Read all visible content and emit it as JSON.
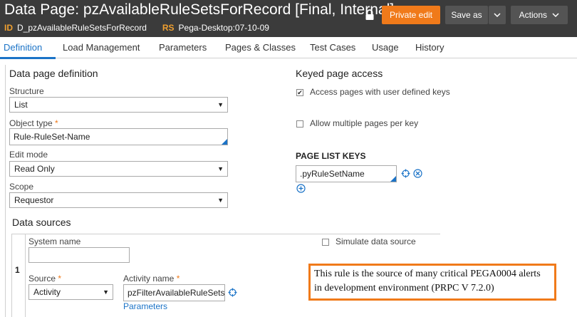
{
  "header": {
    "title": "Data Page: pzAvailableRuleSetsForRecord [Final, Internal]",
    "id_tag": "ID",
    "id_value": "D_pzAvailableRuleSetsForRecord",
    "rs_tag": "RS",
    "rs_value": "Pega-Desktop:07-10-09",
    "private_edit": "Private edit",
    "save_as": "Save as",
    "actions": "Actions"
  },
  "tabs": [
    "Definition",
    "Load Management",
    "Parameters",
    "Pages & Classes",
    "Test Cases",
    "Usage",
    "History"
  ],
  "definition": {
    "heading": "Data page definition",
    "structure_label": "Structure",
    "structure_value": "List",
    "object_type_label": "Object type",
    "object_type_value": "Rule-RuleSet-Name",
    "edit_mode_label": "Edit mode",
    "edit_mode_value": "Read Only",
    "scope_label": "Scope",
    "scope_value": "Requestor",
    "required_mark": "*"
  },
  "keyed": {
    "heading": "Keyed page access",
    "access_label": "Access pages with user defined keys",
    "access_checked": true,
    "allow_label": "Allow multiple pages per key",
    "allow_checked": false,
    "list_keys_heading": "PAGE LIST KEYS",
    "key_value": ".pyRuleSetName"
  },
  "sources": {
    "heading": "Data sources",
    "row_number": "1",
    "system_name_label": "System name",
    "system_name_value": "",
    "simulate_label": "Simulate data source",
    "source_label": "Source",
    "source_value": "Activity",
    "activity_label": "Activity name",
    "activity_value": "pzFilterAvailableRuleSets",
    "parameters_link": "Parameters"
  },
  "annotation": {
    "text": "This rule is the source of many critical PEGA0004 alerts in development environment (PRPC V 7.2.0)"
  },
  "colors": {
    "header_bg": "#3b3b3b",
    "accent": "#f07a1a",
    "link": "#1b73c7"
  }
}
